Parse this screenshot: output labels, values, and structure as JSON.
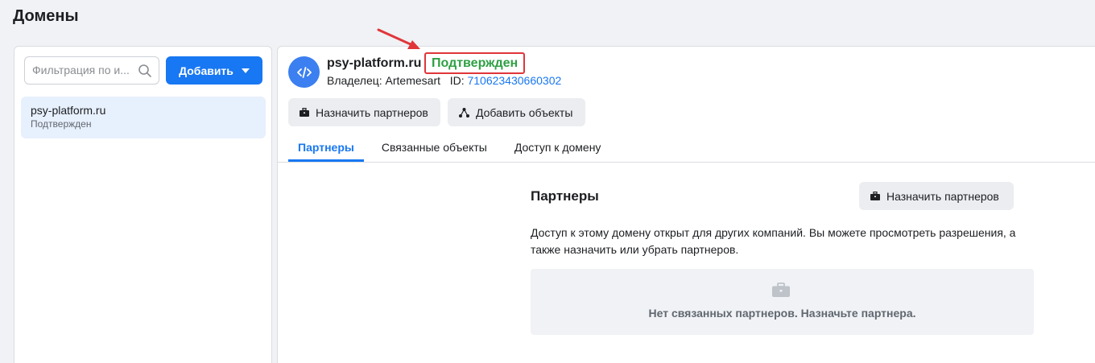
{
  "page": {
    "title": "Домены"
  },
  "sidebar": {
    "filter_placeholder": "Фильтрация по и...",
    "add_button_label": "Добавить",
    "items": [
      {
        "name": "psy-platform.ru",
        "status": "Подтвержден"
      }
    ]
  },
  "detail": {
    "domain_name": "psy-platform.ru",
    "status": "Подтвержден",
    "owner_label": "Владелец:",
    "owner_name": "Artemesart",
    "id_label": "ID:",
    "id_value": "710623430660302",
    "buttons": {
      "assign_partners": "Назначить партнеров",
      "add_objects": "Добавить объекты"
    },
    "tabs": [
      {
        "label": "Партнеры",
        "active": true
      },
      {
        "label": "Связанные объекты",
        "active": false
      },
      {
        "label": "Доступ к домену",
        "active": false
      }
    ],
    "partners_section": {
      "title": "Партнеры",
      "assign_button": "Назначить партнеров",
      "description": "Доступ к этому домену открыт для других компаний. Вы можете просмотреть разрешения, а также назначить или убрать партнеров.",
      "empty_text": "Нет связанных партнеров. Назначьте партнера."
    }
  },
  "colors": {
    "accent": "#1877f2",
    "status_green": "#2ea043",
    "annotation_red": "#e0363a"
  },
  "icons": [
    "search-icon",
    "caret-down-icon",
    "code-icon",
    "briefcase-icon",
    "objects-icon"
  ]
}
